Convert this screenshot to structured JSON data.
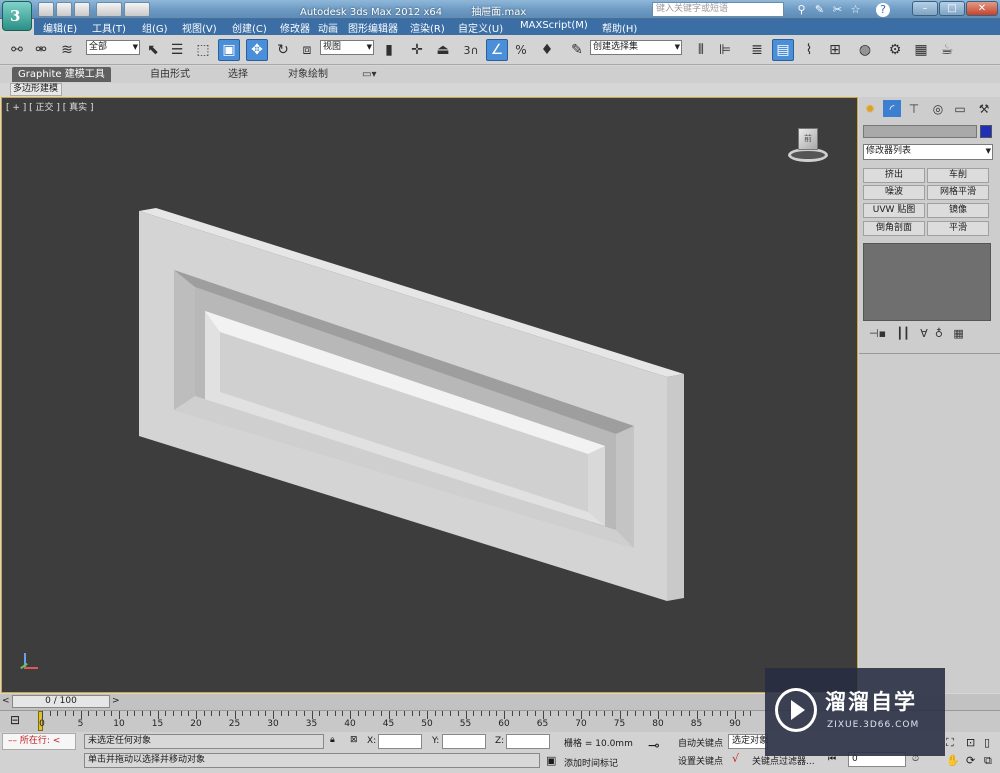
{
  "titlebar": {
    "app_title": "Autodesk 3ds Max  2012 x64",
    "file_name": "抽屉面.max",
    "search_placeholder": "键入关键字或短语",
    "help_label": "?"
  },
  "menubar": {
    "items": [
      "编辑(E)",
      "工具(T)",
      "组(G)",
      "视图(V)",
      "创建(C)",
      "修改器",
      "动画",
      "图形编辑器",
      "渲染(R)",
      "自定义(U)",
      "MAXScript(M)",
      "帮助(H)"
    ]
  },
  "toolbar": {
    "selection_filter": "全部",
    "reference_coord": "视图",
    "named_selection": "创建选择集",
    "snap_label": "3",
    "percent_snap_label": "%"
  },
  "ribbon": {
    "tabs": [
      "Graphite 建模工具",
      "自由形式",
      "选择",
      "对象绘制"
    ],
    "panel_label": "多边形建模"
  },
  "viewport": {
    "label": "[ + ] [ 正交 ] [ 真实 ]",
    "background_color": "#3d3d3d",
    "viewcube_label": "前"
  },
  "command_panel": {
    "modifier_list_label": "修改器列表",
    "object_color": "#1f2fb8",
    "modifier_buttons": [
      "挤出",
      "车削",
      "噪波",
      "网格平滑",
      "UVW 贴图",
      "镜像",
      "倒角剖面",
      "平滑"
    ]
  },
  "timeline": {
    "frame_display": "0 / 100",
    "ticks": [
      "0",
      "5",
      "10",
      "15",
      "20",
      "25",
      "30",
      "35",
      "40",
      "45",
      "50",
      "55",
      "60",
      "65",
      "70",
      "75",
      "80",
      "85",
      "90"
    ]
  },
  "statusbar": {
    "script_label": "所在行:",
    "selection_status": "未选定任何对象",
    "prompt": "单击并拖动以选择并移动对象",
    "x_label": "X:",
    "y_label": "Y:",
    "z_label": "Z:",
    "grid_label": "栅格 = 10.0mm",
    "add_time_tag": "添加时间标记",
    "auto_key_label": "自动关键点",
    "auto_key_value": "选定对象",
    "set_key_label": "设置关键点",
    "key_filters": "关键点过滤器...",
    "frame_value": "0"
  },
  "watermark": {
    "title": "溜溜自学",
    "url": "ZIXUE.3D66.COM"
  }
}
